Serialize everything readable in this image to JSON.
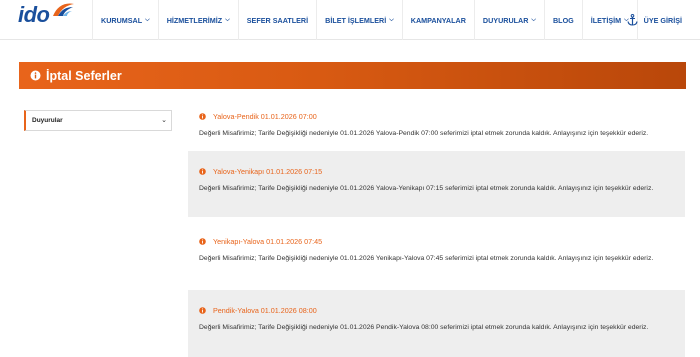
{
  "brand": {
    "logo_text": "ido",
    "accent": "#e8641b",
    "primary": "#1a4f9c"
  },
  "nav": {
    "items": [
      {
        "label": "KURUMSAL",
        "has_dropdown": true
      },
      {
        "label": "HİZMETLERİMİZ",
        "has_dropdown": true
      },
      {
        "label": "SEFER SAATLERİ",
        "has_dropdown": false
      },
      {
        "label": "BİLET İŞLEMLERİ",
        "has_dropdown": true
      },
      {
        "label": "KAMPANYALAR",
        "has_dropdown": false
      },
      {
        "label": "DUYURULAR",
        "has_dropdown": true
      },
      {
        "label": "BLOG",
        "has_dropdown": false
      },
      {
        "label": "İLETİŞİM",
        "has_dropdown": true
      }
    ],
    "member_label": "ÜYE GİRİŞİ",
    "member_icon": "anchor-icon"
  },
  "page": {
    "title": "İptal Seferler",
    "title_icon": "info-circle-icon"
  },
  "sidebar": {
    "selected": "Duyurular"
  },
  "announcements": [
    {
      "title": "Yalova-Pendik 01.01.2026 07:00",
      "body": "Değerli Misafirimiz; Tarife Değişikliği nedeniyle 01.01.2026 Yalova-Pendik 07:00 seferimizi iptal etmek zorunda kaldık. Anlayışınız için teşekkür ederiz."
    },
    {
      "title": "Yalova-Yenikapı 01.01.2026 07:15",
      "body": "Değerli Misafirimiz; Tarife Değişikliği nedeniyle 01.01.2026 Yalova-Yenikapı 07:15 seferimizi iptal etmek zorunda kaldık. Anlayışınız için teşekkür ederiz."
    },
    {
      "title": "Yenikapı-Yalova 01.01.2026 07:45",
      "body": "Değerli Misafirimiz; Tarife Değişikliği nedeniyle 01.01.2026 Yenikapı-Yalova 07:45 seferimizi iptal etmek zorunda kaldık. Anlayışınız için teşekkür ederiz."
    },
    {
      "title": "Pendik-Yalova 01.01.2026 08:00",
      "body": "Değerli Misafirimiz; Tarife Değişikliği nedeniyle 01.01.2026 Pendik-Yalova 08:00 seferimizi iptal etmek zorunda kaldık. Anlayışınız için teşekkür ederiz."
    }
  ]
}
